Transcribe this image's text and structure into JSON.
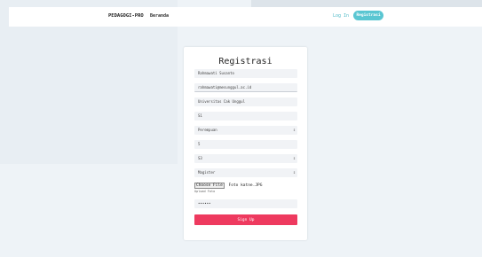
{
  "nav": {
    "brand": "PEDAGOGI-PRO",
    "home": "Beranda",
    "login": "Log In",
    "register": "Registrasi"
  },
  "form": {
    "title": "Registrasi",
    "fields": [
      {
        "value": "Rahmawati Susanto"
      },
      {
        "value": "rahmawati@mesunggul.ac.id"
      },
      {
        "value": "Universitas Cak Unggul"
      },
      {
        "value": "S1"
      },
      {
        "value": "Perempuan"
      },
      {
        "value": "5"
      },
      {
        "value": "S3"
      },
      {
        "value": "Magister"
      }
    ],
    "file_button": "Choose File",
    "file_name": "Foto katne.JPG",
    "file_help": "Upload Foto",
    "password": "••••••",
    "submit": "Sign Up"
  },
  "icons": {
    "select_arrows": "updown-arrows-icon"
  }
}
